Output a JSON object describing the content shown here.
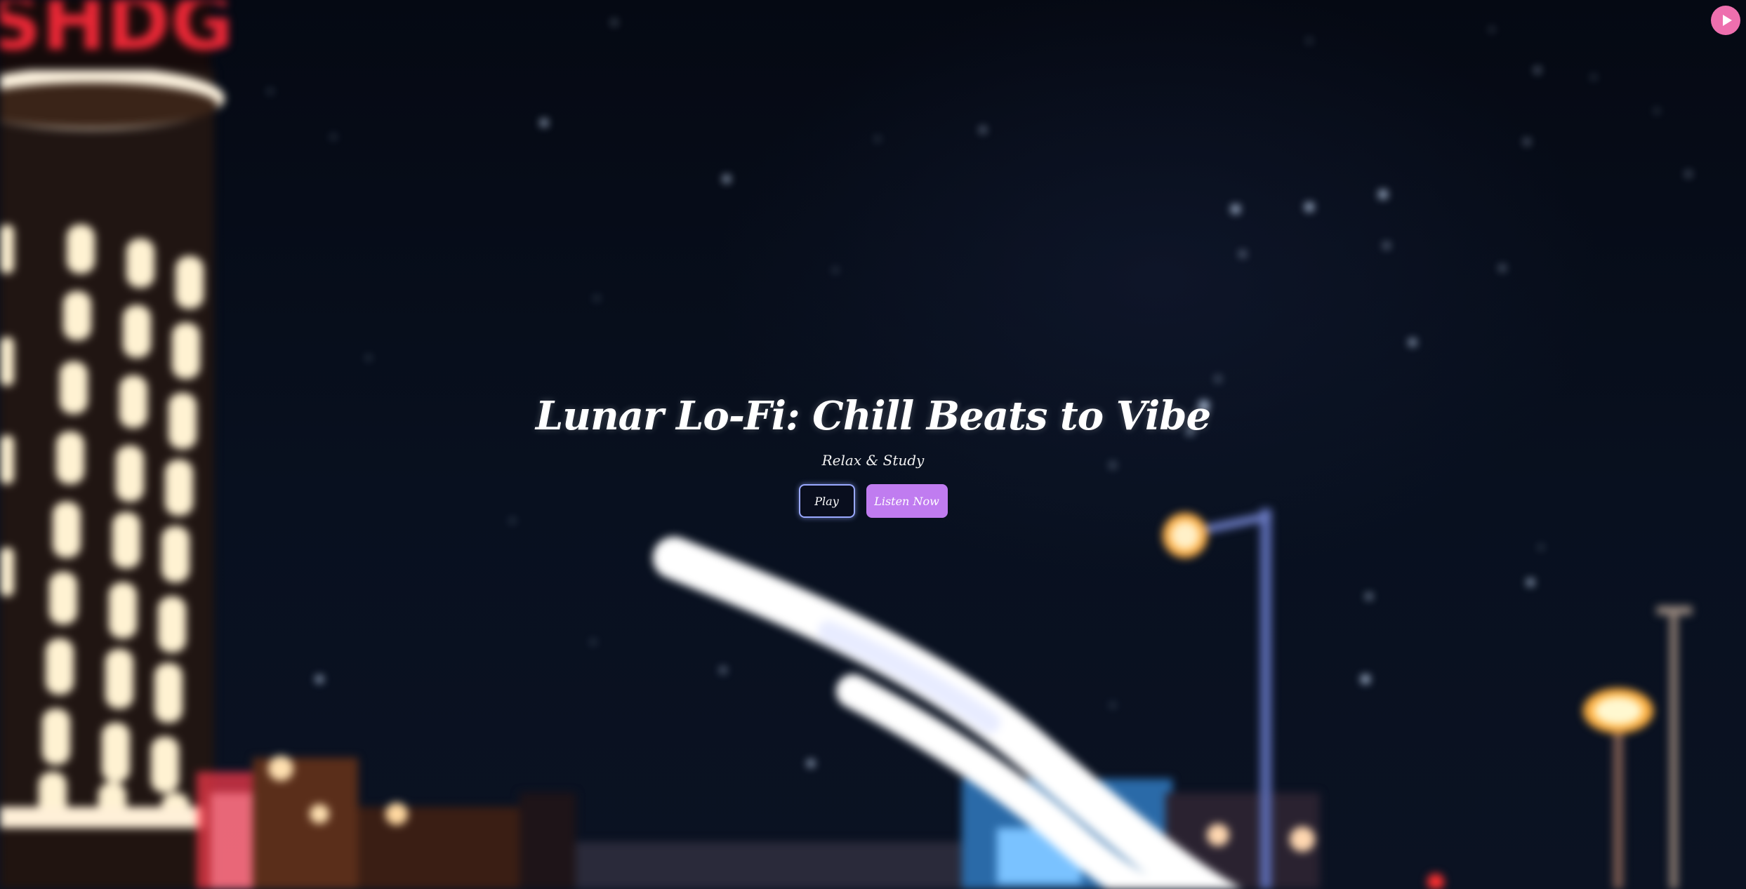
{
  "hero": {
    "title": "Lunar Lo-Fi: Chill Beats to Vibe",
    "subtitle": "Relax & Study",
    "play_label": "Play",
    "listen_label": "Listen Now"
  },
  "floating_button": {
    "icon": "play-icon",
    "color": "#ee6fae"
  },
  "background": {
    "description_icon": "night-city-background"
  },
  "colors": {
    "accent_purple": "#c07cf0",
    "play_border": "#9aa9ff",
    "fab_pink": "#ee6fae"
  }
}
